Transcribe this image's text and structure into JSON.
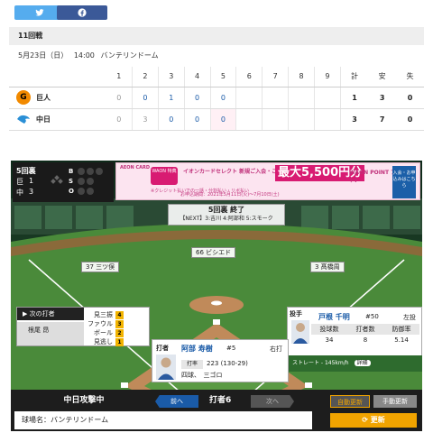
{
  "round_label": "11回戦",
  "match": {
    "date": "5月23日（日）",
    "time": "14:00",
    "venue": "バンテリンドーム"
  },
  "scoreboard": {
    "headers": [
      "1",
      "2",
      "3",
      "4",
      "5",
      "6",
      "7",
      "8",
      "9",
      "計",
      "安",
      "失"
    ],
    "teams": [
      {
        "name": "巨人",
        "innings": [
          "0",
          "0",
          "1",
          "0",
          "0",
          "",
          "",
          "",
          ""
        ],
        "runs": "1",
        "hits": "3",
        "errors": "0",
        "logo_letter": "G"
      },
      {
        "name": "中日",
        "innings": [
          "0",
          "3",
          "0",
          "0",
          "0",
          "",
          "",
          "",
          ""
        ],
        "runs": "3",
        "hits": "7",
        "errors": "0"
      }
    ]
  },
  "bso": {
    "inning": "5回裏",
    "rows": [
      {
        "team": "巨",
        "score": "1"
      },
      {
        "team": "中",
        "score": "3"
      }
    ],
    "labels": {
      "b": "B",
      "s": "S",
      "o": "O"
    },
    "counts": {
      "balls": 0,
      "strikes": 0,
      "outs": 0
    }
  },
  "ad": {
    "brand": "AEON CARD",
    "waon": "WAON 特典",
    "line1": "イオンカードセレクト 新規ご入会・ご利用で",
    "amount": "最大5,500円分",
    "line2": "WAON POINT プレゼント!",
    "line3": "※クレジット払いでの一括・分割払い・リボ払い",
    "cta": "入会・お申込みはこちら",
    "period": "お申込期間：2021年5月11日(火)〜7月10日(土)"
  },
  "status": {
    "title": "5回裏 終了",
    "next": "【NEXT】3:吉川 4:阿部和 5:スモーク"
  },
  "fielders": {
    "lf": "37 三ツ俣",
    "cf": "66 ビシエド",
    "rf": "3 髙橋周"
  },
  "next_batter": {
    "header": "次の打者",
    "name": "根尾 昂",
    "counts": [
      {
        "label": "見三振",
        "value": "4"
      },
      {
        "label": "ファウル",
        "value": "3"
      },
      {
        "label": "ボール",
        "value": "2"
      },
      {
        "label": "見逃し",
        "value": "1"
      }
    ]
  },
  "pitcher": {
    "tag": "投手",
    "name": "戸根 千明",
    "number": "#50",
    "hand": "左投",
    "headers": [
      "投球数",
      "打者数",
      "防御率"
    ],
    "values": [
      "34",
      "8",
      "5.14"
    ],
    "last_pitch": "ストレート - 145km/h",
    "detail": "詳細"
  },
  "batter": {
    "tag": "打者",
    "name": "阿部 寿樹",
    "number": "#5",
    "hand": "右打",
    "avg_label": "打率",
    "avg": "223 (130-29)",
    "history": "四球、　三ゴロ"
  },
  "controls": {
    "attack": "中日攻撃中",
    "prev": "前へ",
    "batter_num": "打者6",
    "next": "次へ",
    "stadium": "球場名：バンテリンドーム",
    "auto": "自動更新",
    "manual": "手動更新",
    "refresh": "更新"
  },
  "colors": {
    "twitter": "#55acee",
    "facebook": "#3b5998",
    "accent": "#f1a400",
    "link": "#1a5ba8"
  }
}
